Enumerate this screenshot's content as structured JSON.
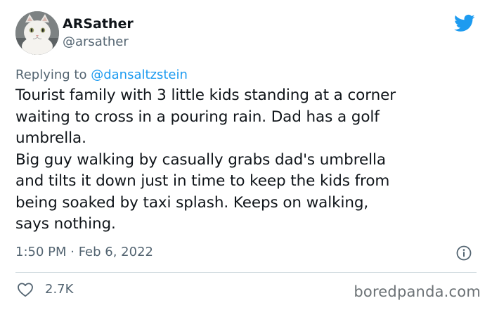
{
  "user": {
    "display_name": "ARSather",
    "handle": "@arsather"
  },
  "reply": {
    "prefix": "Replying to ",
    "mention": "@dansaltzstein"
  },
  "tweet": {
    "text": "Tourist family with 3 little kids standing at a corner\nwaiting to cross in a pouring rain. Dad has a golf\numbrella.\nBig guy walking by casually grabs dad's umbrella\nand tilts it down just in time to keep the kids from\nbeing soaked by taxi splash. Keeps on walking,\nsays nothing.",
    "timestamp": "1:50 PM · Feb 6, 2022",
    "likes": "2.7K"
  },
  "watermark": "boredpanda.com",
  "icons": {
    "brand": "twitter-bird-icon",
    "info": "info-icon",
    "like": "heart-icon"
  },
  "colors": {
    "twitter_blue": "#1d9bf0",
    "secondary_text": "#536471",
    "primary_text": "#0f1419"
  }
}
